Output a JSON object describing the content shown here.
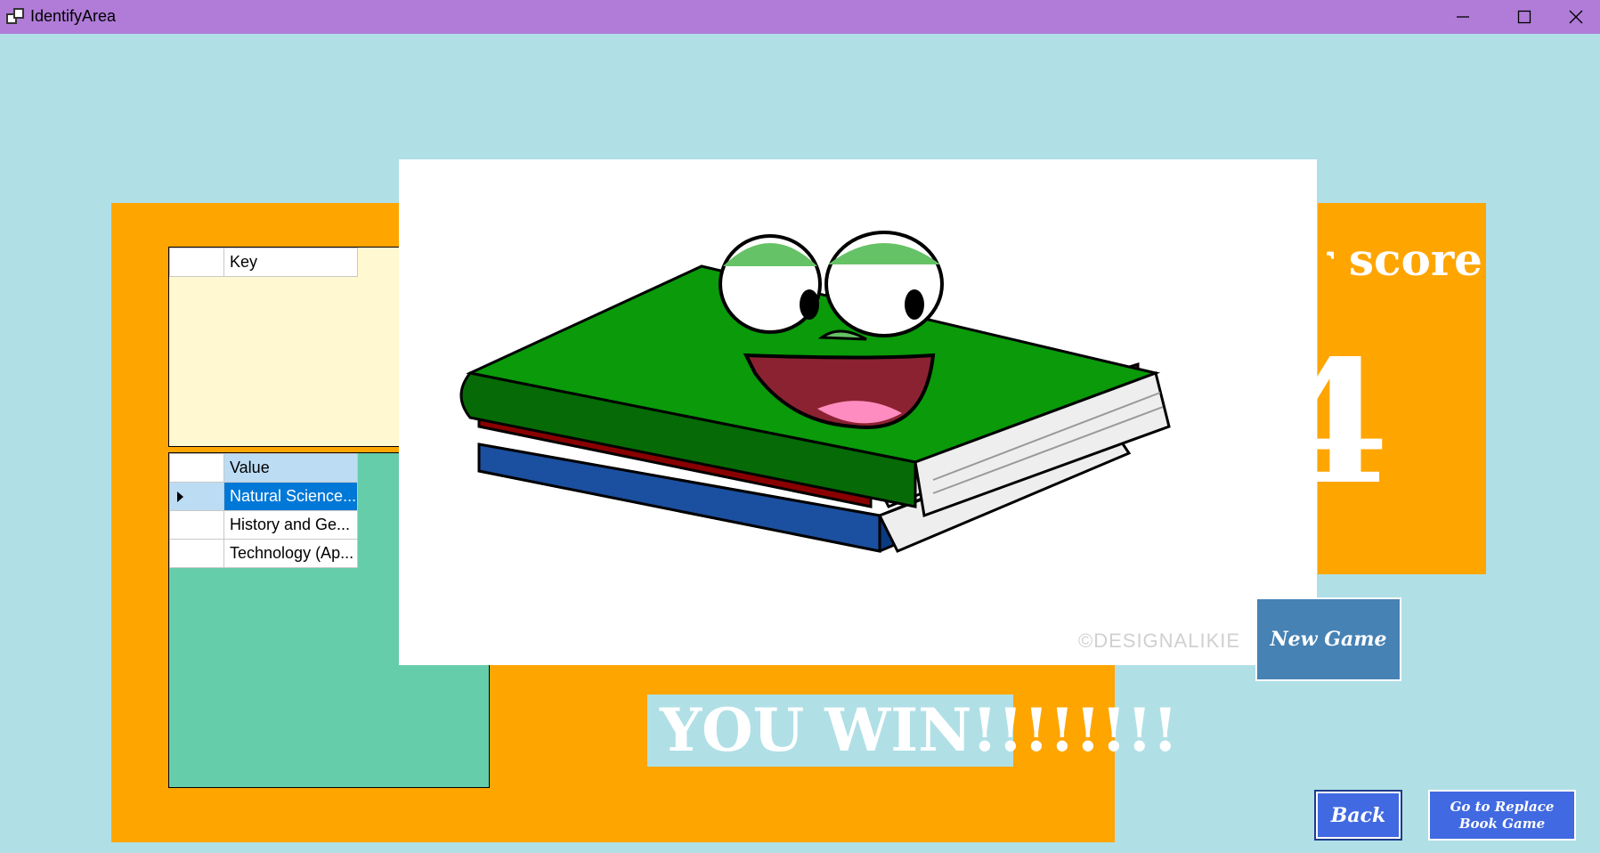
{
  "window": {
    "title": "IdentifyArea",
    "controls": {
      "minimize_icon": "minimize-icon",
      "maximize_icon": "maximize-icon",
      "close_icon": "close-icon"
    }
  },
  "key_grid": {
    "row_header": "",
    "column_header": "Key",
    "rows": []
  },
  "value_grid": {
    "column_header": "Value",
    "rows": [
      {
        "value": "Natural Science...",
        "selected": true
      },
      {
        "value": "History and Ge..."
      },
      {
        "value": "Technology (Ap..."
      }
    ]
  },
  "score": {
    "label": "Your score:",
    "value": "4"
  },
  "picture": {
    "description_icon": "smiling-books-illustration",
    "watermark": "©DESIGNALIKIE"
  },
  "result_banner": "YOU WIN!!!!!!!!",
  "buttons": {
    "new_game": "New Game",
    "back": "Back",
    "replace_line1": "Go to Replace",
    "replace_line2": "Book Game"
  },
  "colors": {
    "background": "#b0e0e6",
    "titlebar": "#b07cd8",
    "panel": "#ffa500",
    "key_grid_bg": "#fff8d0",
    "value_grid_bg": "#66cdaa",
    "selection": "#0078d7",
    "new_game_button": "#4682b4",
    "nav_button": "#4169e1"
  }
}
